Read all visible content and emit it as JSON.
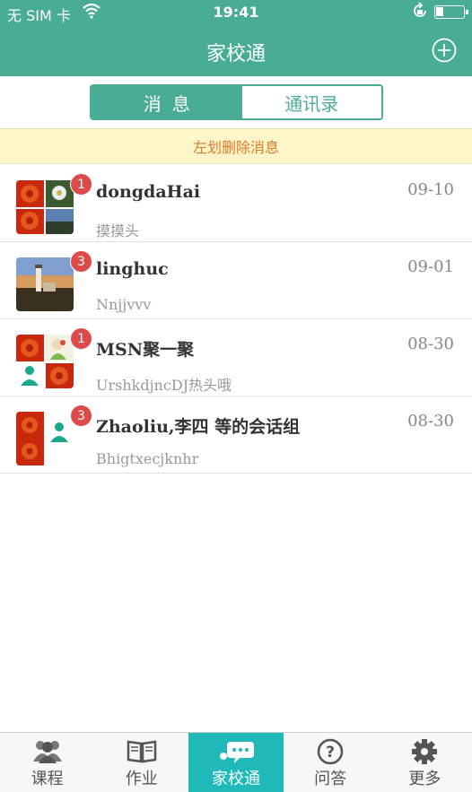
{
  "status_bar": {
    "carrier": "无 SIM 卡",
    "time": "19:41"
  },
  "header": {
    "title": "家校通"
  },
  "segment": {
    "messages": "消息",
    "contacts": "通讯录"
  },
  "hint": "左划删除消息",
  "conversations": [
    {
      "name": "dongdaHai",
      "preview": "摸摸头",
      "date": "09-10",
      "badge": "1"
    },
    {
      "name": "linghuc",
      "preview": "Nnjjvvv",
      "date": "09-01",
      "badge": "3"
    },
    {
      "name": "MSN聚一聚",
      "preview": "UrshkdjncDJ热头哦",
      "date": "08-30",
      "badge": "1"
    },
    {
      "name": "Zhaoliu,李四 等的会话组",
      "preview": "Bhigtxecjknhr",
      "date": "08-30",
      "badge": "3"
    }
  ],
  "tabbar": [
    {
      "label": "课程",
      "icon": "people-icon"
    },
    {
      "label": "作业",
      "icon": "book-icon"
    },
    {
      "label": "家校通",
      "icon": "chat-bubble-icon"
    },
    {
      "label": "问答",
      "icon": "question-icon"
    },
    {
      "label": "更多",
      "icon": "gear-icon"
    }
  ],
  "colors": {
    "primary": "#49ad96",
    "active_tab": "#1fb9b9",
    "badge": "#dc4a4a",
    "hint_bg": "#fdf6c8",
    "hint_text": "#e07a2e"
  }
}
